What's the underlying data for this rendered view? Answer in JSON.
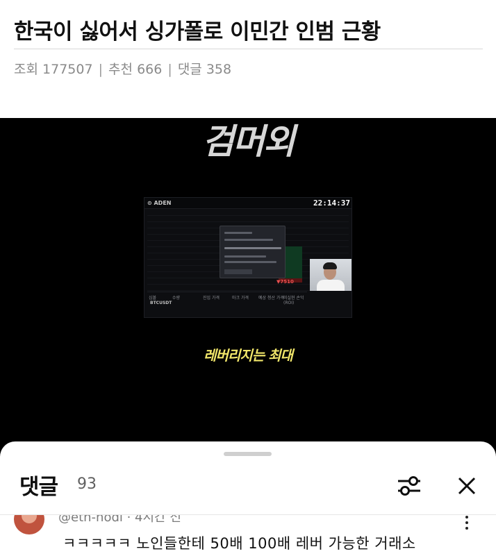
{
  "post": {
    "title": "한국이 싫어서 싱가폴로 이민간 인범 근황",
    "meta": {
      "views_label": "조회",
      "views": "177507",
      "recommend_label": "추천",
      "recommend": "666",
      "comments_label": "댓글",
      "comments": "358",
      "separator": "|"
    }
  },
  "video": {
    "caption_top": "검머외",
    "caption_bottom": "레버리지는 최대",
    "screen": {
      "logo": "⊙ ADEN",
      "clock": "22:14:37",
      "price": "▼7510",
      "ticker": "BTCUSDT",
      "table_headers": [
        "심볼",
        "수량",
        "진입 가격",
        "마크 가격",
        "예상 청산 가격",
        "미실현 손익(ROI)"
      ]
    }
  },
  "comments_sheet": {
    "title": "댓글",
    "count": "93",
    "comment": {
      "author": "@eth-hodl · 4시간 전",
      "text": "ㅋㅋㅋㅋㅋ 노인들한테 50배 100배 레버 가능한 거래소"
    }
  },
  "icons": {
    "filter": "sliders-icon",
    "close": "close-icon",
    "more": "more-vertical-icon"
  }
}
